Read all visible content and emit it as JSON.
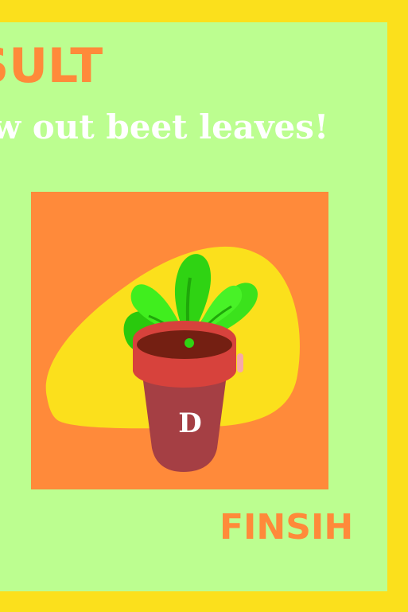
{
  "result": {
    "title": "SULT",
    "message": "w out beet leaves!"
  },
  "card": {
    "plant_icon": "potted-beet-seedling-icon",
    "pot_label": "D"
  },
  "finish_button": {
    "label": "FINSIH"
  },
  "colors": {
    "frame": "#fbe01c",
    "panel": "#bcfe90",
    "accent": "#ff8a3a",
    "text_light": "#ffffff"
  }
}
